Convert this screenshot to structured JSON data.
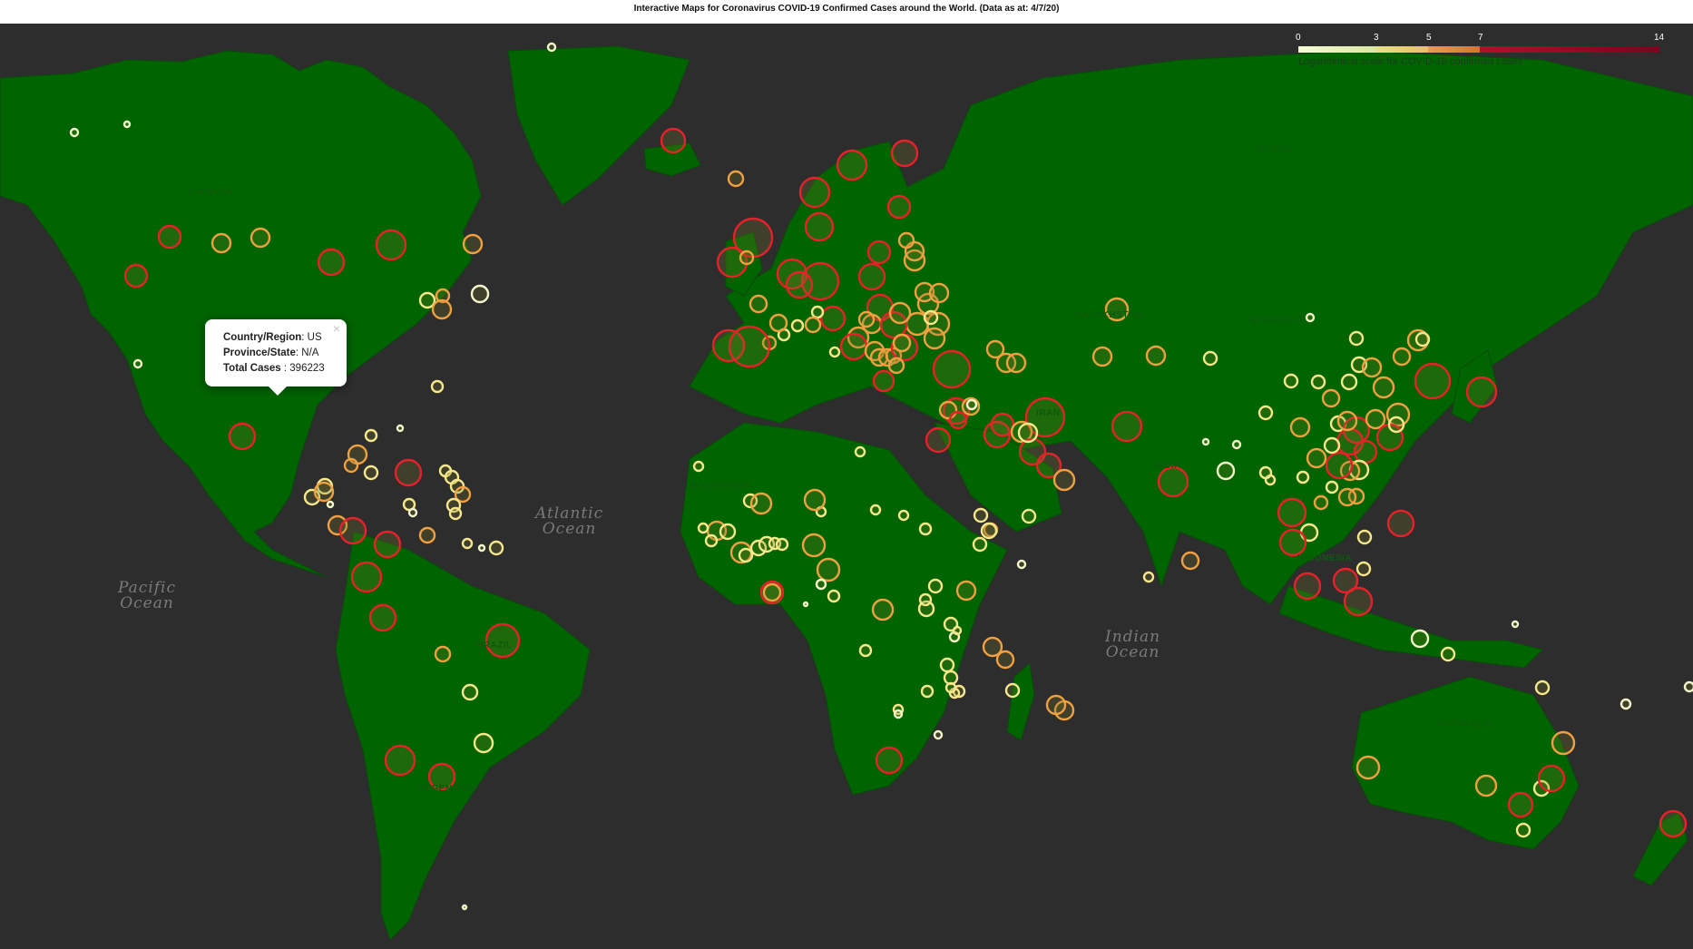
{
  "title": "Interactive Maps for Coronavirus COVID-19 Confirmed Cases around the World. (Data as at: 4/7/20)",
  "colors": {
    "ocean": "#2d2d2d",
    "land": "#006400",
    "marker_yellow": "#f5e78a",
    "marker_orange": "#f0a040",
    "marker_red": "#e8202a",
    "marker_pale": "#f3f6c8"
  },
  "legend": {
    "ticks": [
      "0",
      "3",
      "5",
      "7",
      "14"
    ],
    "caption": "Logarithmical scale for COVID-19 confirmed cases",
    "colors": [
      "#f7fcd8",
      "#e8c866",
      "#e8903a",
      "#990022"
    ]
  },
  "popup": {
    "country_label": "Country/Region",
    "country_value": ": US",
    "province_label": "Province/State",
    "province_value": ": N/A",
    "cases_label": "Total Cases",
    "cases_value": " : 396223",
    "close_glyph": "×"
  },
  "ocean_labels": [
    {
      "line1": "Atlantic",
      "line2": "Ocean"
    },
    {
      "line1": "Pacific",
      "line2": "Ocean"
    },
    {
      "line1": "Indian",
      "line2": "Ocean"
    }
  ],
  "country_labels": [
    "CANADA",
    "RUSSIA",
    "KAZAKHSTAN",
    "MONGOLIA",
    "BRAZIL",
    "AUSTRALIA",
    "MAURITANIA",
    "INDIA",
    "IRAN",
    "ARGENTINA",
    "INDONESIA"
  ],
  "markers": [
    {
      "c": "pale"
    },
    {
      "c": "pale"
    },
    {
      "c": "yellow"
    },
    {
      "c": "red"
    },
    {
      "c": "orange"
    }
  ]
}
